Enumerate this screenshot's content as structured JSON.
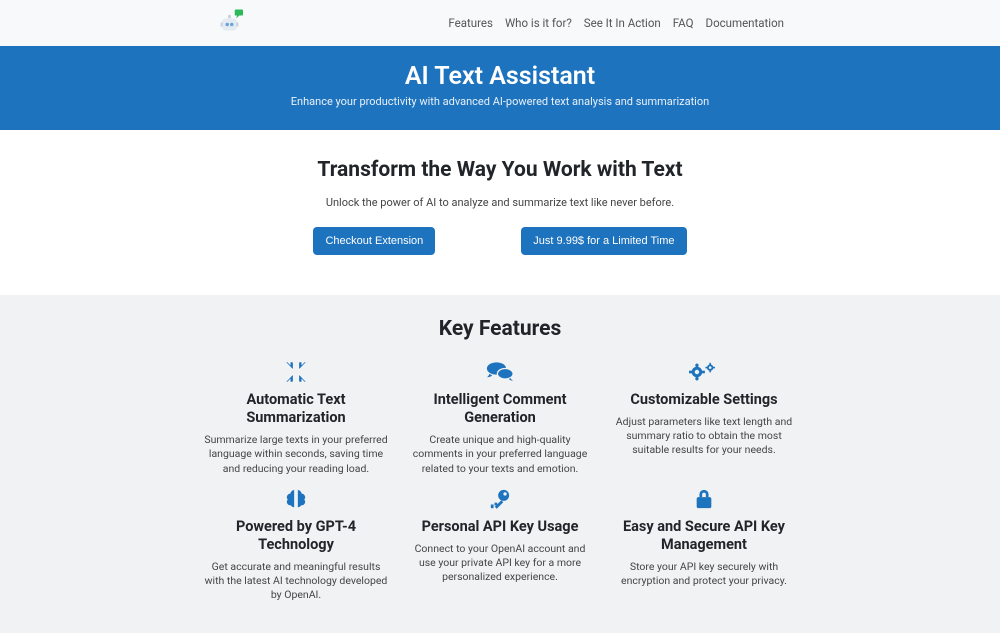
{
  "nav": {
    "items": [
      "Features",
      "Who is it for?",
      "See It In Action",
      "FAQ",
      "Documentation"
    ]
  },
  "hero": {
    "title": "AI Text Assistant",
    "subtitle": "Enhance your productivity with advanced AI-powered text analysis and summarization"
  },
  "intro": {
    "title": "Transform the Way You Work with Text",
    "subtitle": "Unlock the power of AI to analyze and summarize text like never before.",
    "button1": "Checkout Extension",
    "button2": "Just 9.99$ for a Limited Time"
  },
  "features": {
    "title": "Key Features",
    "items": [
      {
        "title": "Automatic Text Summarization",
        "desc": "Summarize large texts in your preferred language within seconds, saving time and reducing your reading load."
      },
      {
        "title": "Intelligent Comment Generation",
        "desc": "Create unique and high-quality comments in your preferred language related to your texts and emotion."
      },
      {
        "title": "Customizable Settings",
        "desc": "Adjust parameters like text length and summary ratio to obtain the most suitable results for your needs."
      },
      {
        "title": "Powered by GPT-4 Technology",
        "desc": "Get accurate and meaningful results with the latest AI technology developed by OpenAI."
      },
      {
        "title": "Personal API Key Usage",
        "desc": "Connect to your OpenAI account and use your private API key for a more personalized experience."
      },
      {
        "title": "Easy and Secure API Key Management",
        "desc": "Store your API key securely with encryption and protect your privacy."
      }
    ]
  }
}
